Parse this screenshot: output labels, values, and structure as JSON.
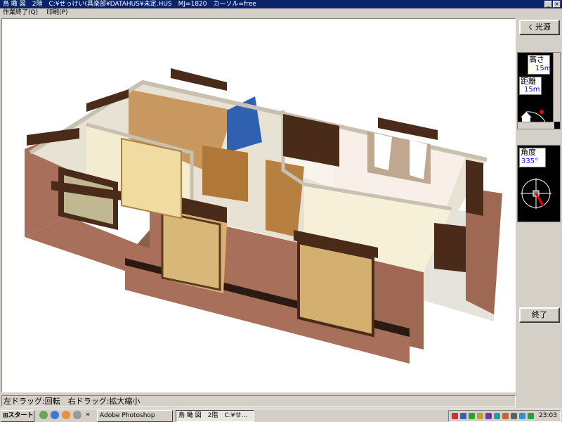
{
  "window": {
    "title": "鳥 瞰 図　2階　C:¥せっけい(具楽部¥DATAHUS¥未定.HUS　MJ=1820　カーソル=free",
    "min": "_",
    "close": "×"
  },
  "menu": {
    "items": [
      "作業終了(Q)",
      "印刷(P)"
    ]
  },
  "panel": {
    "light_label": "光源",
    "height_label": "高さ",
    "height_value": "15m",
    "distance_label": "距離",
    "distance_value": "15m",
    "angle_label": "角度",
    "angle_value": "335°",
    "end_label": "終了"
  },
  "status": {
    "text": "左ドラッグ:回転　右ドラッグ:拡大縮小"
  },
  "taskbar": {
    "start": "スタート",
    "more": "»",
    "tasks": [
      "Adobe Photoshop",
      "鳥 瞰 図　2階　C:¥せ..."
    ],
    "clock": "23:03"
  },
  "colors": {
    "brick": "#a8705a",
    "wall_top": "#c8c0b0",
    "floor": "#d8b070",
    "window_frame": "#4a2a18",
    "titlebar": "#0a246a"
  }
}
